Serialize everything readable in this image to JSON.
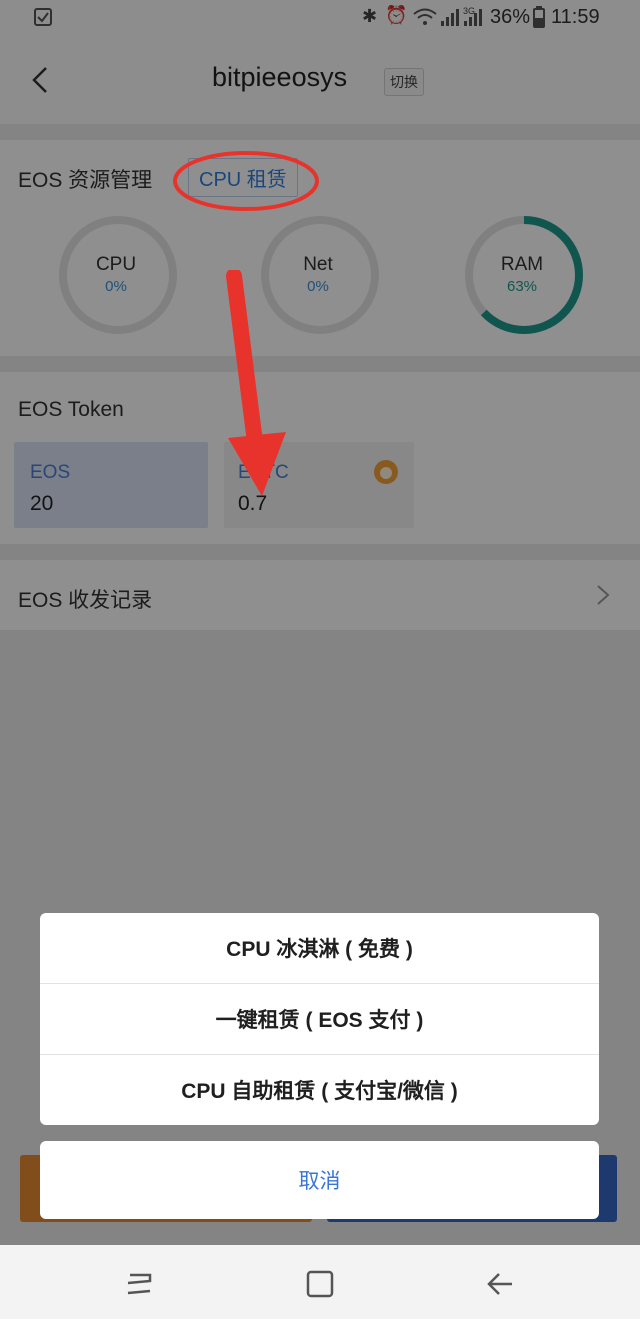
{
  "status_bar": {
    "battery": "36%",
    "time": "11:59",
    "network": "3G"
  },
  "header": {
    "title": "bitpieeosys",
    "switch_label": "切换"
  },
  "resources": {
    "title": "EOS 资源管理",
    "rent_button": "CPU 租赁",
    "rings": [
      {
        "label": "CPU",
        "value": "0%",
        "fill": 0
      },
      {
        "label": "Net",
        "value": "0%",
        "fill": 0
      },
      {
        "label": "RAM",
        "value": "63%",
        "fill": 0.63
      }
    ]
  },
  "tokens": {
    "title": "EOS Token",
    "items": [
      {
        "symbol": "EOS",
        "amount": "20"
      },
      {
        "symbol": "EBTC",
        "amount": "0.7"
      }
    ]
  },
  "records": {
    "title": "EOS 收发记录"
  },
  "action_sheet": {
    "options": [
      "CPU 冰淇淋 ( 免费 )",
      "一键租赁 ( EOS 支付 )",
      "CPU 自助租赁 ( 支付宝/微信 )"
    ],
    "cancel": "取消"
  },
  "colors": {
    "accent_blue": "#3b8fd8",
    "ram_teal": "#1e9a8e",
    "annotation_red": "#e8332c"
  }
}
